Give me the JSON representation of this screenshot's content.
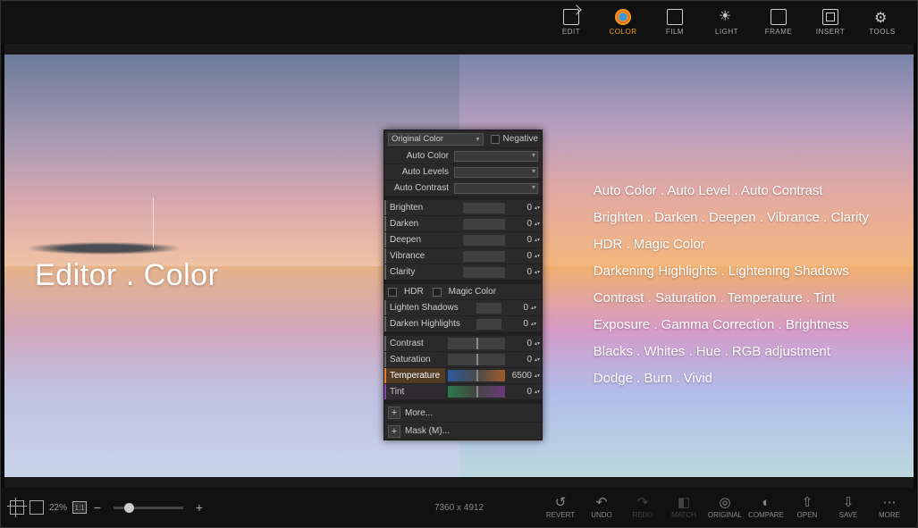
{
  "toolbar": {
    "edit": "EDIT",
    "color": "COLOR",
    "film": "FILM",
    "light": "LIGHT",
    "frame": "FRAME",
    "insert": "INSERT",
    "tools": "TOOLS"
  },
  "title": "Editor . Color",
  "panel": {
    "original_color": "Original Color",
    "negative": "Negative",
    "auto_color": "Auto Color",
    "auto_levels": "Auto Levels",
    "auto_contrast": "Auto Contrast",
    "hdr": "HDR",
    "magic_color": "Magic Color",
    "more": "More...",
    "mask": "Mask (M)...",
    "sliders": [
      {
        "name": "Brighten",
        "value": "0"
      },
      {
        "name": "Darken",
        "value": "0"
      },
      {
        "name": "Deepen",
        "value": "0"
      },
      {
        "name": "Vibrance",
        "value": "0"
      },
      {
        "name": "Clarity",
        "value": "0"
      }
    ],
    "sliders2": [
      {
        "name": "Lighten Shadows",
        "value": "0"
      },
      {
        "name": "Darken Highlights",
        "value": "0"
      }
    ],
    "sliders3": {
      "contrast": {
        "name": "Contrast",
        "value": "0"
      },
      "saturation": {
        "name": "Saturation",
        "value": "0"
      },
      "temperature": {
        "name": "Temperature",
        "value": "6500"
      },
      "tint": {
        "name": "Tint",
        "value": "0"
      }
    }
  },
  "features": {
    "l1": "Auto Color . Auto Level . Auto Contrast",
    "l2": "Brighten . Darken . Deepen .  Vibrance . Clarity",
    "l3": "HDR . Magic Color",
    "l4": "Darkening Highlights . Lightening Shadows",
    "l5": "Contrast . Saturation . Temperature . Tint",
    "l6": "Exposure . Gamma Correction . Brightness",
    "l7": "Blacks . Whites . Hue . RGB adjustment",
    "l8": "Dodge . Burn . Vivid"
  },
  "bottom": {
    "zoom": "22%",
    "one": "1:1",
    "dims": "7360 x 4912",
    "revert": "REVERT",
    "undo": "UNDO",
    "redo": "REDO",
    "match": "MATCH",
    "original": "ORIGINAL",
    "compare": "COMPARE",
    "open": "OPEN",
    "save": "SAVE",
    "more": "MORE"
  }
}
